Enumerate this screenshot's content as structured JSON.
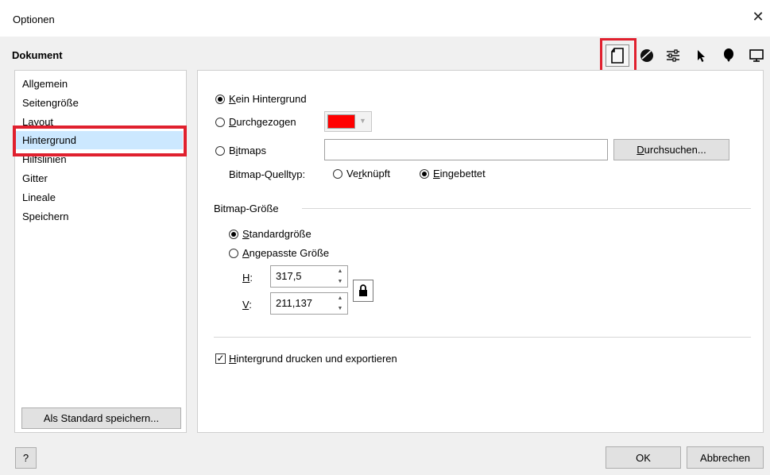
{
  "window": {
    "title": "Optionen",
    "close_glyph": "✕"
  },
  "header": {
    "title": "Dokument"
  },
  "toolbar": {
    "icons": [
      "document-icon",
      "color-management-icon",
      "settings-sliders-icon",
      "pointer-icon",
      "balloon-icon",
      "monitor-icon"
    ],
    "selected_icon": "document-icon",
    "highlight_color": "#e0202e"
  },
  "sidebar": {
    "items": [
      {
        "label": "Allgemein"
      },
      {
        "label": "Seitengröße"
      },
      {
        "label": "Layout"
      },
      {
        "label": "Hintergrund"
      },
      {
        "label": "Hilfslinien"
      },
      {
        "label": "Gitter"
      },
      {
        "label": "Lineale"
      },
      {
        "label": "Speichern"
      }
    ],
    "selected": "Hintergrund",
    "save_default_label": "Als Standard speichern..."
  },
  "background": {
    "none": {
      "prefix": "K",
      "rest": "ein Hintergrund",
      "checked": true
    },
    "solid": {
      "prefix": "D",
      "rest": "urchgezogen",
      "checked": false,
      "color": "#ff0000"
    },
    "bitmaps": {
      "pre": "B",
      "key": "i",
      "rest": "tmaps",
      "checked": false,
      "path_value": ""
    },
    "browse_label": "Durchsuchen...",
    "browse_prefix": "D",
    "browse_rest": "urchsuchen...",
    "source_type": {
      "label": "Bitmap-Quelltyp:",
      "linked": {
        "pre": "Ve",
        "key": "r",
        "rest": "knüpft",
        "checked": false
      },
      "embedded": {
        "key": "E",
        "rest": "ingebettet",
        "checked": true
      }
    }
  },
  "bitmap_size": {
    "group_label": "Bitmap-Größe",
    "standard": {
      "key": "S",
      "rest": "tandardgröße",
      "checked": true
    },
    "custom": {
      "key": "A",
      "rest": "ngepasste Größe",
      "checked": false
    },
    "h_label_key": "H",
    "h_label_rest": ":",
    "h_value": "317,5",
    "v_label_key": "V",
    "v_label_rest": ":",
    "v_value": "211,137",
    "lock_icon": "lock-icon"
  },
  "print_export": {
    "key": "H",
    "rest": "intergrund drucken und exportieren",
    "checked": true
  },
  "footer": {
    "help_label": "?",
    "ok_label": "OK",
    "cancel_label": "Abbrechen"
  }
}
